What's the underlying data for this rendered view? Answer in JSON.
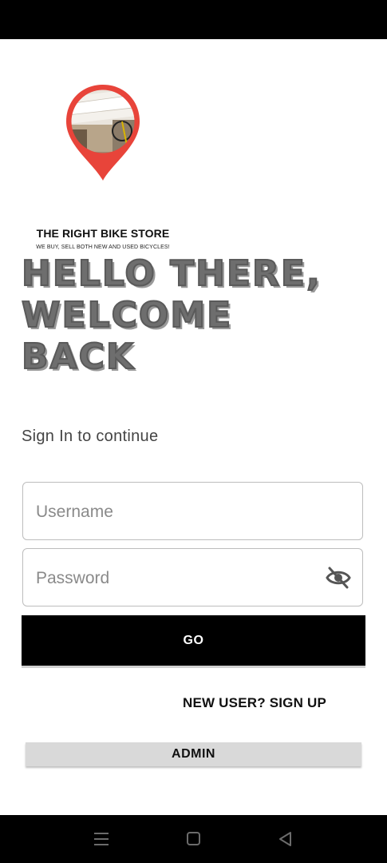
{
  "brand": {
    "title": "THE RIGHT BIKE STORE",
    "tagline": "WE BUY, SELL BOTH NEW AND USED BICYCLES!",
    "pin_color": "#e8443a"
  },
  "headline": {
    "line1": "HELLO THERE,",
    "line2": "WELCOME",
    "line3": "BACK"
  },
  "subtitle": "Sign In to continue",
  "form": {
    "username_placeholder": "Username",
    "username_value": "",
    "password_placeholder": "Password",
    "password_value": "",
    "password_toggle_icon": "eye-off-icon"
  },
  "buttons": {
    "go": "GO",
    "signup": "NEW USER? SIGN UP",
    "admin": "ADMIN"
  },
  "nav": {
    "menu_icon": "menu-icon",
    "home_icon": "home-square-icon",
    "back_icon": "back-triangle-icon"
  }
}
